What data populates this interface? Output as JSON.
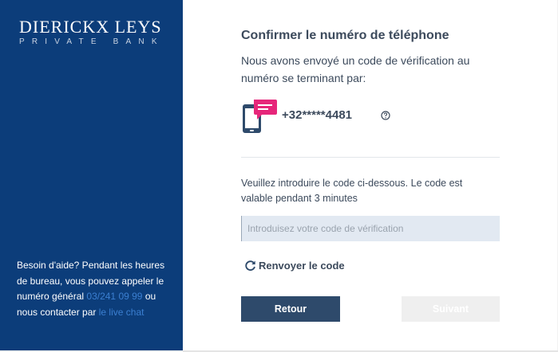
{
  "brand": {
    "name": "DIERICKX LEYS",
    "tagline": "PRIVATE BANK"
  },
  "sidebar": {
    "help_text_1": "Besoin d'aide? Pendant les heures de bureau, vous pouvez appeler le numéro général",
    "phone_link": "03/241 09 99",
    "help_text_2": "ou nous contacter par",
    "chat_link": "le live chat"
  },
  "main": {
    "title": "Confirmer le numéro de téléphone",
    "subtitle": "Nous avons envoyé un code de vérification au numéro se terminant par:",
    "phone_number": "+32*****4481",
    "instruction": "Veuillez introduire le code ci-dessous. Le code est valable pendant 3 minutes",
    "code_input": {
      "value": "",
      "placeholder": "Introduisez votre code de vérification"
    },
    "resend_label": "Renvoyer le code",
    "back_button": "Retour",
    "next_button": "Suivant",
    "next_button_disabled": true
  },
  "icons": {
    "phone": "phone-message-icon",
    "help": "question-circle-icon",
    "resend": "refresh-icon"
  },
  "colors": {
    "sidebar_bg": "#0c3d7a",
    "primary_button": "#2e4a6b",
    "disabled_button": "#efefef",
    "link": "#3b7fd1",
    "message_bubble": "#e6267a",
    "phone_icon": "#2e4a6b",
    "text": "#3c4a5c"
  }
}
